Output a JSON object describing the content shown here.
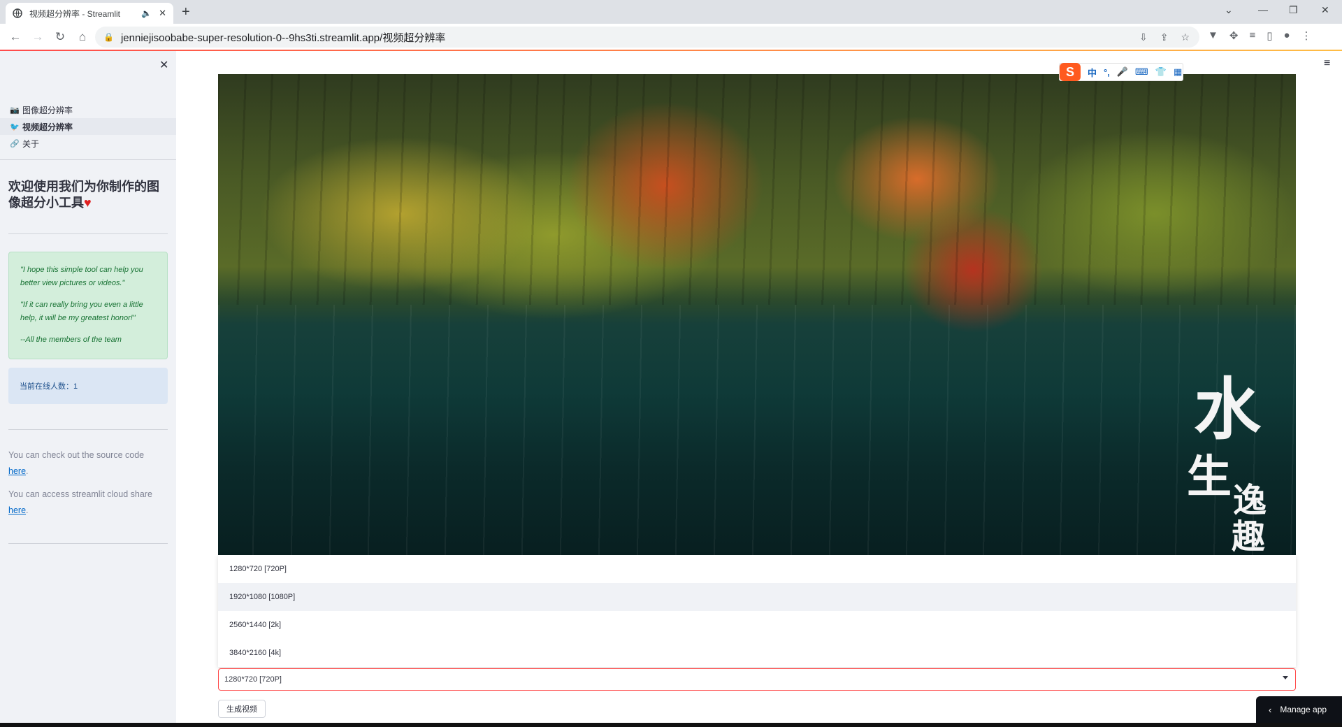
{
  "browser": {
    "tab_title": "视频超分辨率 - Streamlit",
    "speaker_icon": "speaker-icon",
    "url": "jenniejisoobabe-super-resolution-0--9hs3ti.streamlit.app/视频超分辨率"
  },
  "sidebar": {
    "nav": [
      {
        "icon": "📷",
        "label": "图像超分辨率"
      },
      {
        "icon": "🐦",
        "label": "视频超分辨率"
      },
      {
        "icon": "🔗",
        "label": "关于"
      }
    ],
    "welcome": "欢迎使用我们为你制作的图像超分小工具",
    "quote_lines": [
      "\"I hope this simple tool can help you better view pictures or videos.\"",
      "\"If it can really bring you even a little help, it will be my greatest honor!\"",
      "--All the members of the team"
    ],
    "online": "当前在线人数：1",
    "source_text": "You can check out the source code",
    "source_link": "here",
    "share_text": "You can access streamlit cloud share",
    "share_link": "here",
    "period": "."
  },
  "ime": {
    "items": [
      "中",
      "°,",
      "🎤",
      "⌨",
      "👕",
      "▦"
    ]
  },
  "video": {
    "calligraphy": [
      "水",
      "生",
      "逸",
      "趣"
    ]
  },
  "select": {
    "options": [
      "1280*720 [720P]",
      "1920*1080 [1080P]",
      "2560*1440 [2k]",
      "3840*2160 [4k]"
    ],
    "value": "1280*720 [720P]"
  },
  "generate_button": "生成视频",
  "manage_app": "Manage app",
  "colors": {
    "accent": "#ff4b4b",
    "sidebar_bg": "#f0f2f6",
    "quote_bg": "#d3eedb",
    "info_bg": "#dbe6f4"
  }
}
